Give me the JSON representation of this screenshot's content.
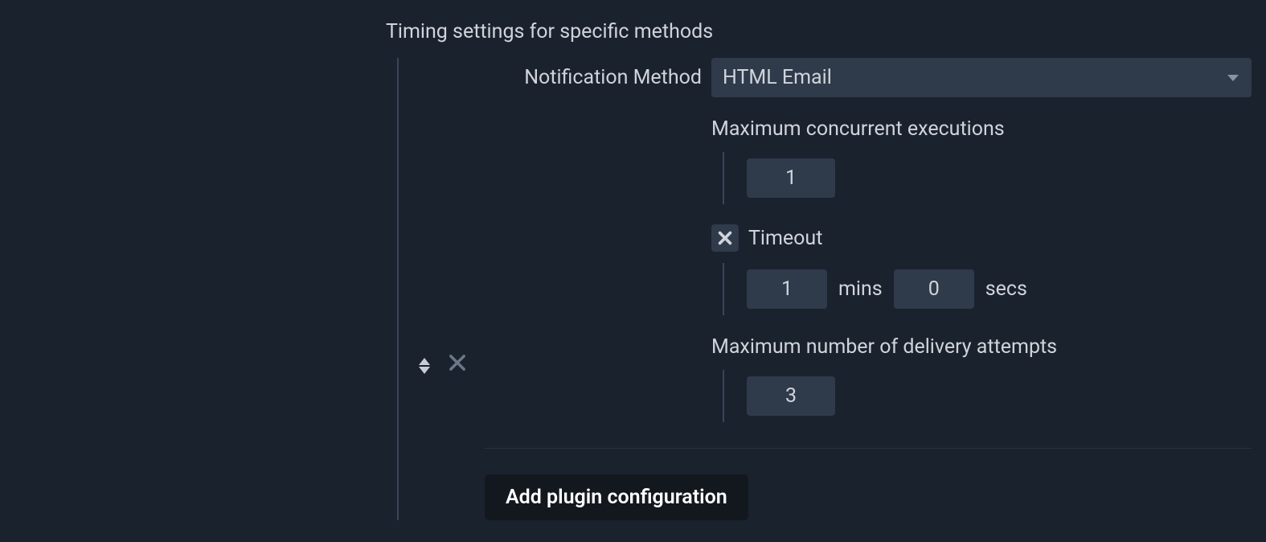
{
  "section": {
    "title": "Timing settings for specific methods"
  },
  "form": {
    "notification_method": {
      "label": "Notification Method",
      "value": "HTML Email"
    },
    "max_concurrent": {
      "label": "Maximum concurrent executions",
      "value": "1"
    },
    "timeout": {
      "label": "Timeout",
      "checked": true,
      "mins_value": "1",
      "mins_unit": "mins",
      "secs_value": "0",
      "secs_unit": "secs"
    },
    "max_attempts": {
      "label": "Maximum number of delivery attempts",
      "value": "3"
    }
  },
  "buttons": {
    "add_config": "Add plugin configuration"
  }
}
